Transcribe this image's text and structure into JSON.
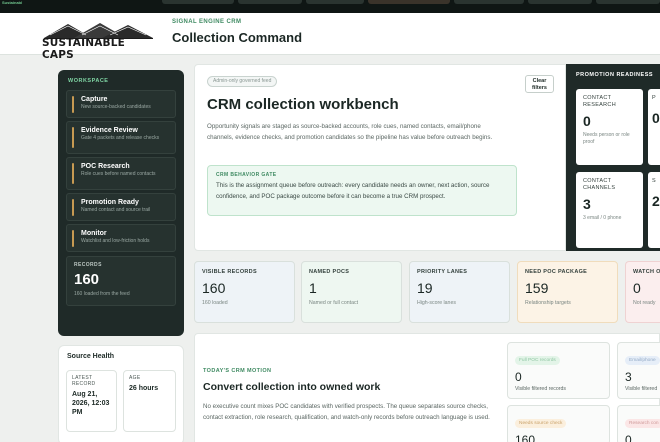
{
  "topbar": {
    "brand": "Sustainabl"
  },
  "header": {
    "logo_text": "SUSTAINABLE CAPS",
    "eyebrow": "SIGNAL ENGINE CRM",
    "title": "Collection Command"
  },
  "sidebar": {
    "heading": "WORKSPACE",
    "items": [
      {
        "title": "Capture",
        "sub": "New source-backed candidates"
      },
      {
        "title": "Evidence Review",
        "sub": "Gate 4 packets and release checks"
      },
      {
        "title": "POC Research",
        "sub": "Role cues before named contacts"
      },
      {
        "title": "Promotion Ready",
        "sub": "Named contact and source trail"
      },
      {
        "title": "Monitor",
        "sub": "Watchlist and low-friction holds"
      }
    ],
    "records": {
      "label": "RECORDS",
      "value": "160",
      "sub": "160 loaded from the feed"
    }
  },
  "source_health": {
    "title": "Source Health",
    "latest_record": {
      "label1": "LATEST",
      "label2": "RECORD",
      "value": "Aug 21, 2026, 12:03 PM"
    },
    "age": {
      "label": "AGE",
      "value": "26 hours"
    }
  },
  "workbench": {
    "badge": "Admin-only governed feed",
    "clear_button": "Clear filters",
    "title": "CRM collection workbench",
    "description": "Opportunity signals are staged as source-backed accounts, role cues, named contacts, email/phone channels, evidence checks, and promotion candidates so the pipeline has value before outreach begins.",
    "gate": {
      "label": "CRM BEHAVIOR GATE",
      "text": "This is the assignment queue before outreach: every candidate needs an owner, next action, source confidence, and POC package outcome before it can become a true CRM prospect."
    }
  },
  "promotion": {
    "heading": "PROMOTION READINESS",
    "cards": [
      {
        "label": "CONTACT RESEARCH",
        "value": "0",
        "sub": "Needs person or role proof"
      },
      {
        "label": "CONTACT CHANNELS",
        "value": "3",
        "sub": "3 email / 0 phone"
      }
    ],
    "peek": [
      {
        "label": "P",
        "value": "0"
      },
      {
        "label": "S",
        "value": "2"
      }
    ]
  },
  "metrics": [
    {
      "label": "VISIBLE RECORDS",
      "value": "160",
      "sub": "160 loaded",
      "bg": "#eef3f7"
    },
    {
      "label": "NAMED POCS",
      "value": "1",
      "sub": "Named or full contact",
      "bg": "#eef7f1"
    },
    {
      "label": "PRIORITY LANES",
      "value": "19",
      "sub": "High-score lanes",
      "bg": "#eef3f7"
    },
    {
      "label": "NEED POC PACKAGE",
      "value": "159",
      "sub": "Relationship targets",
      "bg": "#fcf3e6"
    },
    {
      "label": "WATCH O",
      "value": "0",
      "sub": "Not ready",
      "bg": "#fbeeee"
    }
  ],
  "motion": {
    "eyebrow": "TODAY'S CRM MOTION",
    "title": "Convert collection into owned work",
    "description": "No executive count mixes POC candidates with verified prospects. The queue separates source checks, contact extraction, role research, qualification, and watch-only records before outreach language is used.",
    "cards": [
      {
        "pill": "Full POC records",
        "value": "0",
        "sub": "Visible filtered records",
        "pill_bg": "#e3f4e8",
        "pill_color": "#8fc6a2"
      },
      {
        "pill": "Email/phone",
        "value": "3",
        "sub": "Visible filtered",
        "pill_bg": "#e6eef8",
        "pill_color": "#93aac6"
      },
      {
        "pill": "Needs source check",
        "value": "160",
        "sub": "",
        "pill_bg": "#fbefdd",
        "pill_color": "#c9a26a"
      },
      {
        "pill": "Research con",
        "value": "0",
        "sub": "",
        "pill_bg": "#fbe6e6",
        "pill_color": "#cf9a9a"
      }
    ]
  },
  "colors": {
    "accent": "#3f8a62",
    "dark": "#1f2a28",
    "nav_bar": "#c79a52"
  }
}
